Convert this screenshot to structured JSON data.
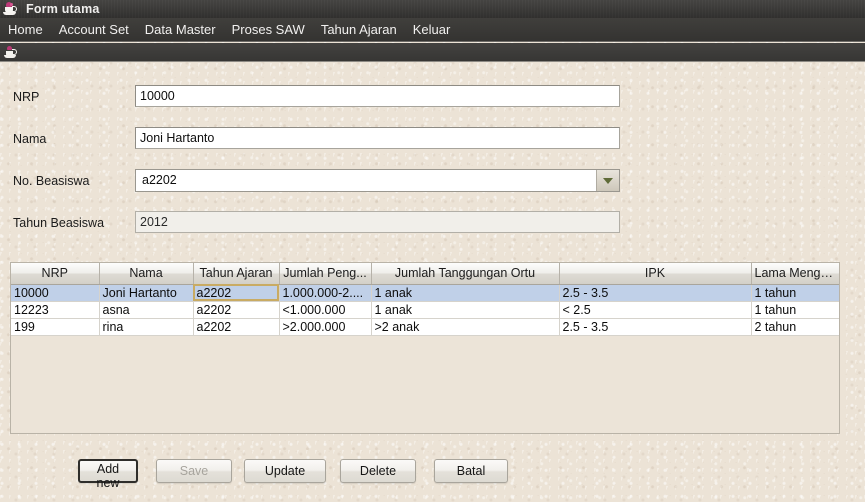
{
  "window": {
    "title": "Form utama",
    "icon": "java-duke-icon"
  },
  "menubar": {
    "items": [
      {
        "label": "Home",
        "name": "menu-home"
      },
      {
        "label": "Account Set",
        "name": "menu-account-set"
      },
      {
        "label": "Data Master",
        "name": "menu-data-master"
      },
      {
        "label": "Proses SAW",
        "name": "menu-proses-saw"
      },
      {
        "label": "Tahun Ajaran",
        "name": "menu-tahun-ajaran"
      },
      {
        "label": "Keluar",
        "name": "menu-keluar"
      }
    ]
  },
  "toolbar": {
    "icon": "java-cup-icon"
  },
  "form": {
    "fields": [
      {
        "label": "NRP",
        "value": "10000",
        "type": "text",
        "disabled": false
      },
      {
        "label": "Nama",
        "value": "Joni Hartanto",
        "type": "text",
        "disabled": false
      },
      {
        "label": "No. Beasiswa",
        "value": "a2202",
        "type": "combo",
        "disabled": false
      },
      {
        "label": "Tahun Beasiswa",
        "value": "2012",
        "type": "text",
        "disabled": true
      }
    ]
  },
  "table": {
    "columns": [
      "NRP",
      "Nama",
      "Tahun Ajaran",
      "Jumlah Peng...",
      "Jumlah Tanggungan Ortu",
      "IPK",
      "Lama Menga..."
    ],
    "rows": [
      {
        "selected": true,
        "cells": [
          "10000",
          "Joni Hartanto",
          "a2202",
          "1.000.000-2....",
          "1 anak",
          "2.5 - 3.5",
          "1 tahun"
        ],
        "focus_cell_index": 2
      },
      {
        "selected": false,
        "cells": [
          "12223",
          "asna",
          "a2202",
          "<1.000.000",
          "1 anak",
          "< 2.5",
          "1 tahun"
        ],
        "focus_cell_index": -1
      },
      {
        "selected": false,
        "cells": [
          "199",
          "rina",
          "a2202",
          ">2.000.000",
          ">2 anak",
          "2.5 - 3.5",
          "2 tahun"
        ],
        "focus_cell_index": -1
      }
    ]
  },
  "buttons": [
    {
      "label": "Add new",
      "name": "add-new-button",
      "state": "focused"
    },
    {
      "label": "Save",
      "name": "save-button",
      "state": "disabled"
    },
    {
      "label": "Update",
      "name": "update-button",
      "state": "normal"
    },
    {
      "label": "Delete",
      "name": "delete-button",
      "state": "normal"
    },
    {
      "label": "Batal",
      "name": "cancel-button",
      "state": "normal"
    }
  ],
  "colors": {
    "titlebar": "#3b3a38",
    "background": "#ece3d6",
    "selection": "#c0d0e8",
    "focus_cell_border": "#c9ab63",
    "combo_arrow": "#5f6b38"
  }
}
